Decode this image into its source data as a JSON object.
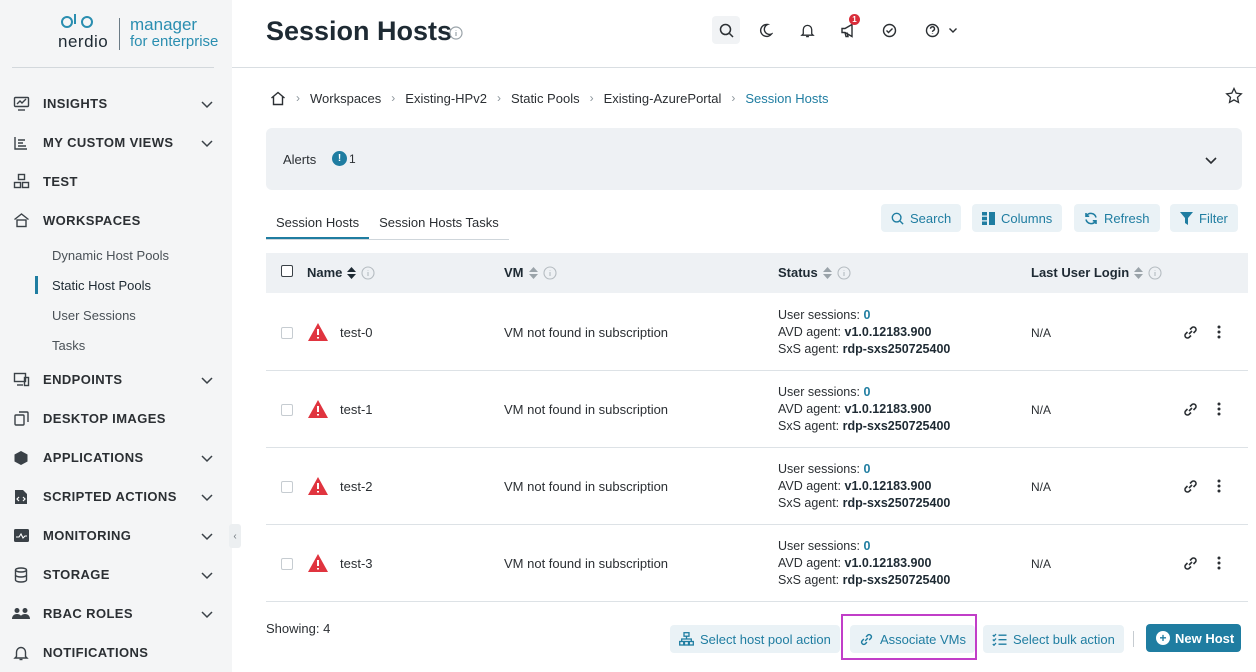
{
  "brand": {
    "name": "nerdio",
    "product_line1": "manager",
    "product_line2": "for enterprise",
    "accent": "#1f7da1"
  },
  "sidebar": {
    "items": [
      {
        "label": "INSIGHTS",
        "icon": "insights-icon",
        "expandable": true
      },
      {
        "label": "MY CUSTOM VIEWS",
        "icon": "custom-views-icon",
        "expandable": true
      },
      {
        "label": "TEST",
        "icon": "test-icon",
        "expandable": false
      },
      {
        "label": "WORKSPACES",
        "icon": "workspaces-icon",
        "expandable": false,
        "children": [
          "Dynamic Host Pools",
          "Static Host Pools",
          "User Sessions",
          "Tasks"
        ]
      },
      {
        "label": "ENDPOINTS",
        "icon": "endpoints-icon",
        "expandable": true
      },
      {
        "label": "DESKTOP IMAGES",
        "icon": "desktop-images-icon",
        "expandable": false
      },
      {
        "label": "APPLICATIONS",
        "icon": "applications-icon",
        "expandable": true
      },
      {
        "label": "SCRIPTED ACTIONS",
        "icon": "scripted-actions-icon",
        "expandable": true
      },
      {
        "label": "MONITORING",
        "icon": "monitoring-icon",
        "expandable": true
      },
      {
        "label": "STORAGE",
        "icon": "storage-icon",
        "expandable": true
      },
      {
        "label": "RBAC ROLES",
        "icon": "rbac-roles-icon",
        "expandable": true
      },
      {
        "label": "NOTIFICATIONS",
        "icon": "notifications-icon",
        "expandable": false
      }
    ],
    "active_child": "Static Host Pools"
  },
  "header": {
    "title": "Session Hosts",
    "announcement_badge": "1"
  },
  "breadcrumb": [
    "Workspaces",
    "Existing-HPv2",
    "Static Pools",
    "Existing-AzurePortal",
    "Session Hosts"
  ],
  "alerts": {
    "label": "Alerts",
    "badge": "!",
    "count": "1"
  },
  "tabs": [
    "Session Hosts",
    "Session Hosts Tasks"
  ],
  "toolbar": {
    "search": "Search",
    "columns": "Columns",
    "refresh": "Refresh",
    "filter": "Filter"
  },
  "table": {
    "columns": [
      "Name",
      "VM",
      "Status",
      "Last User Login"
    ],
    "status_labels": {
      "sessions": "User sessions:",
      "avd": "AVD agent:",
      "sxs": "SxS agent:"
    },
    "rows": [
      {
        "name": "test-0",
        "vm": "VM not found in subscription",
        "sessions": "0",
        "avd": "v1.0.12183.900",
        "sxs": "rdp-sxs250725400",
        "last_login": "N/A"
      },
      {
        "name": "test-1",
        "vm": "VM not found in subscription",
        "sessions": "0",
        "avd": "v1.0.12183.900",
        "sxs": "rdp-sxs250725400",
        "last_login": "N/A"
      },
      {
        "name": "test-2",
        "vm": "VM not found in subscription",
        "sessions": "0",
        "avd": "v1.0.12183.900",
        "sxs": "rdp-sxs250725400",
        "last_login": "N/A"
      },
      {
        "name": "test-3",
        "vm": "VM not found in subscription",
        "sessions": "0",
        "avd": "v1.0.12183.900",
        "sxs": "rdp-sxs250725400",
        "last_login": "N/A"
      }
    ]
  },
  "footer": {
    "showing": "Showing: 4",
    "select_host_pool_action": "Select host pool action",
    "associate_vms": "Associate VMs",
    "select_bulk_action": "Select bulk action",
    "new_host": "New Host"
  }
}
